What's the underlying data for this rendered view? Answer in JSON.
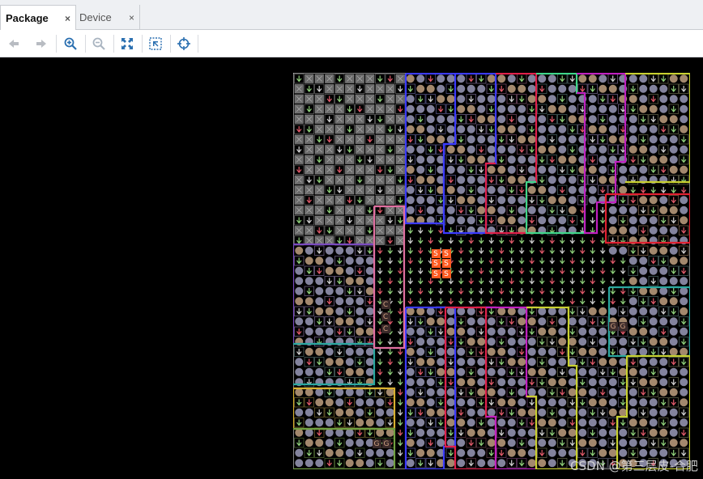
{
  "tabs": [
    {
      "label": "Package",
      "active": true,
      "close_glyph": "×"
    },
    {
      "label": "Device",
      "active": false,
      "close_glyph": "×"
    }
  ],
  "toolbar": {
    "buttons": [
      {
        "name": "back-button",
        "icon": "arrow-left-icon",
        "enabled": false
      },
      {
        "name": "forward-button",
        "icon": "arrow-right-icon",
        "enabled": false
      },
      {
        "name": "zoom-in-button",
        "icon": "zoom-in-icon",
        "enabled": true
      },
      {
        "name": "zoom-out-button",
        "icon": "zoom-out-icon",
        "enabled": false
      },
      {
        "name": "zoom-fit-button",
        "icon": "zoom-fit-icon",
        "enabled": true
      },
      {
        "name": "zoom-area-button",
        "icon": "zoom-area-icon",
        "enabled": true
      },
      {
        "name": "autofit-selection-button",
        "icon": "crosshair-icon",
        "enabled": true
      }
    ]
  },
  "package_view": {
    "grid_label_texts": [
      "S",
      "S",
      "S",
      "S",
      "S",
      "S",
      "G",
      "G",
      "G",
      "G",
      "C",
      "C",
      "C"
    ],
    "colors": {
      "background": "#000000",
      "border": "#ffffff",
      "io_bank_blue": "#3b3bff",
      "io_bank_red": "#e0204a",
      "io_bank_magenta": "#c020c0",
      "io_bank_green": "#3fd68a",
      "io_bank_yellow": "#c8d030",
      "io_bank_teal": "#2aa8a0",
      "io_bank_gold": "#d8b030",
      "io_bank_pink": "#e070a0"
    }
  },
  "watermark": "CSDN @第三层皮-合肥"
}
